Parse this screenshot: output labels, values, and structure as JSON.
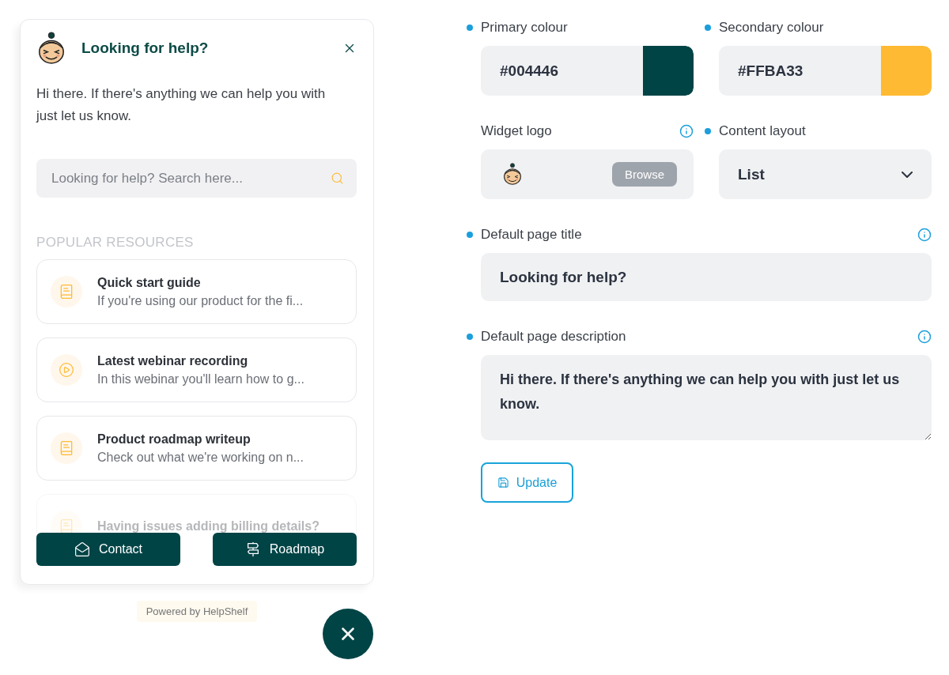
{
  "widget": {
    "title": "Looking for help?",
    "description": "Hi there. If there's anything we can help you with just let us know.",
    "search": {
      "placeholder": "Looking for help? Search here..."
    },
    "section_heading": "POPULAR RESOURCES",
    "resources": [
      {
        "kind": "guide",
        "title": "Quick start guide",
        "summary": "If you're using our product for the fi...",
        "faded": false
      },
      {
        "kind": "video",
        "title": "Latest webinar recording",
        "summary": "In this webinar you'll learn how to g...",
        "faded": false
      },
      {
        "kind": "guide",
        "title": "Product roadmap writeup",
        "summary": "Check out what we're working on n...",
        "faded": false
      },
      {
        "kind": "guide",
        "title": "Having issues adding billing details?",
        "faded": true
      }
    ],
    "buttons": [
      {
        "kind": "contact",
        "label": "Contact"
      },
      {
        "kind": "roadmap",
        "label": "Roadmap"
      }
    ],
    "powered_by": "Powered by HelpShelf"
  },
  "settings": {
    "fields": [
      {
        "kind": "color",
        "label": "Primary colour",
        "required": true,
        "info": false,
        "value": "#004446",
        "color": "#004446"
      },
      {
        "kind": "color",
        "label": "Secondary colour",
        "required": true,
        "info": false,
        "value": "#FFBA33",
        "color": "#ffba33"
      },
      {
        "kind": "logo",
        "label": "Widget logo",
        "required": false,
        "info": true,
        "button": "Browse"
      },
      {
        "kind": "select",
        "label": "Content layout",
        "required": true,
        "info": false,
        "value": "List"
      },
      {
        "kind": "text",
        "label": "Default page title",
        "required": true,
        "info": true,
        "value": "Looking for help?"
      },
      {
        "kind": "textarea",
        "label": "Default page description",
        "required": true,
        "info": true,
        "value": "Hi there. If there's anything we can help you with just let us know."
      }
    ],
    "submit": "Update"
  }
}
